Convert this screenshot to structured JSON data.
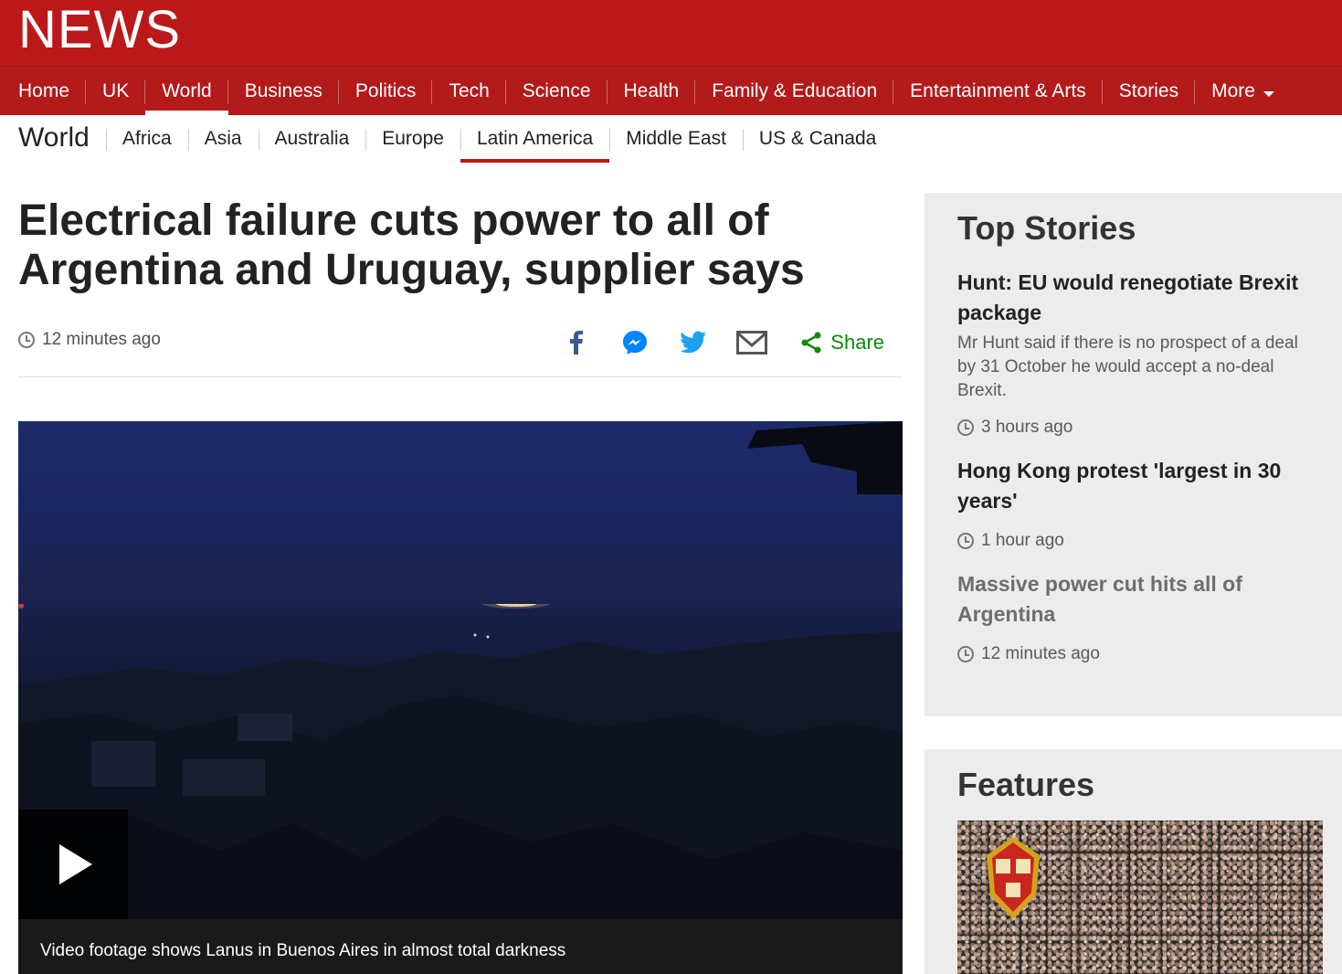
{
  "brand": {
    "logo_text": "NEWS",
    "color": "#bb1919"
  },
  "primary_nav": {
    "items": [
      {
        "label": "Home"
      },
      {
        "label": "UK"
      },
      {
        "label": "World",
        "active": true
      },
      {
        "label": "Business"
      },
      {
        "label": "Politics"
      },
      {
        "label": "Tech"
      },
      {
        "label": "Science"
      },
      {
        "label": "Health"
      },
      {
        "label": "Family & Education"
      },
      {
        "label": "Entertainment & Arts"
      },
      {
        "label": "Stories"
      },
      {
        "label": "More"
      }
    ]
  },
  "secondary_nav": {
    "section": "World",
    "items": [
      {
        "label": "Africa"
      },
      {
        "label": "Asia"
      },
      {
        "label": "Australia"
      },
      {
        "label": "Europe"
      },
      {
        "label": "Latin America",
        "active": true
      },
      {
        "label": "Middle East"
      },
      {
        "label": "US & Canada"
      }
    ]
  },
  "article": {
    "headline": "Electrical failure cuts power to all of Argentina and Uruguay, supplier says",
    "timestamp": "12 minutes ago",
    "share_label": "Share",
    "share_icons": [
      "facebook-icon",
      "messenger-icon",
      "twitter-icon",
      "email-icon",
      "share-icon"
    ],
    "video_caption": "Video footage shows Lanus in Buenos Aires in almost total darkness"
  },
  "top_stories": {
    "title": "Top Stories",
    "stories": [
      {
        "title": "Hunt: EU would renegotiate Brexit package",
        "summary": "Mr Hunt said if there is no prospect of a deal by 31 October he would accept a no-deal Brexit.",
        "time": "3 hours ago"
      },
      {
        "title": "Hong Kong protest 'largest in 30 years'",
        "time": "1 hour ago"
      },
      {
        "title": "Massive power cut hits all of Argentina",
        "time": "12 minutes ago"
      }
    ]
  },
  "features": {
    "title": "Features"
  }
}
